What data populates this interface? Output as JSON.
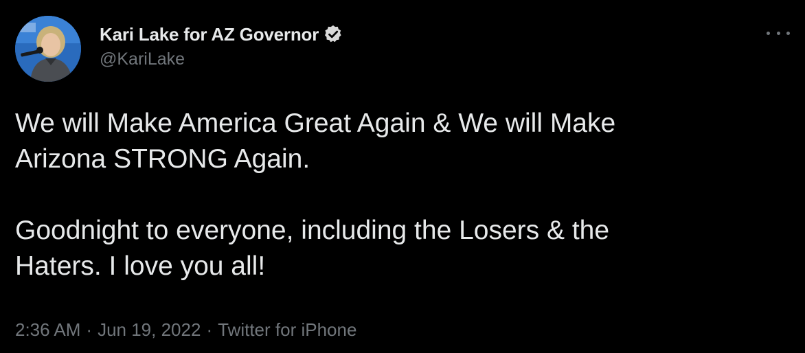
{
  "author": {
    "display_name": "Kari Lake for AZ Governor",
    "handle": "@KariLake",
    "verified": true,
    "avatar_icon": "profile-photo"
  },
  "tweet": {
    "lines": [
      "We will Make America Great Again & We will Make",
      "Arizona STRONG Again.",
      "Goodnight to everyone, including the Losers & the",
      "Haters. I love you all!"
    ]
  },
  "meta": {
    "time": "2:36 AM",
    "date": "Jun 19, 2022",
    "source": "Twitter for iPhone",
    "separator": "·"
  },
  "colors": {
    "background": "#000000",
    "primary_text": "#e7e9ea",
    "secondary_text": "#71767b",
    "verified_badge": "#d9d9d9"
  },
  "icons": {
    "more": "more-horizontal-icon",
    "verified": "verified-badge-icon"
  }
}
